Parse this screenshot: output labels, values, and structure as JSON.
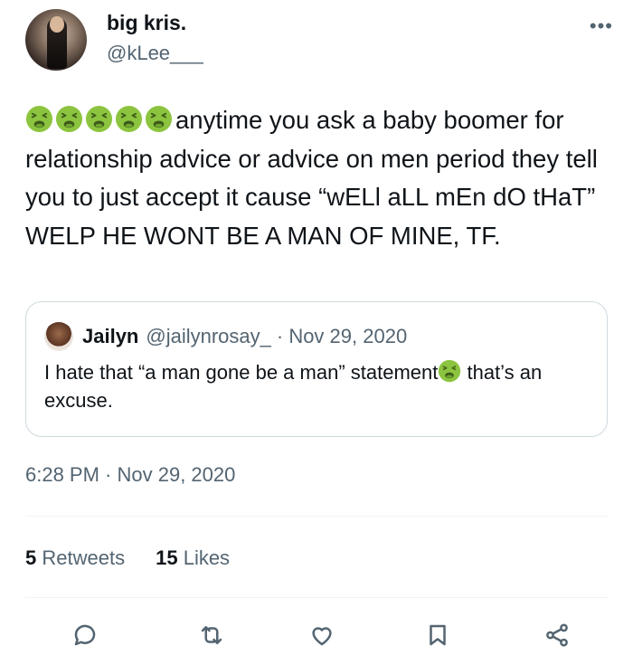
{
  "author": {
    "name": "big kris.",
    "handle": "@kLee___"
  },
  "more_label": "•••",
  "tweet": {
    "emoji_prefix": [
      "nauseated-face",
      "nauseated-face",
      "nauseated-face",
      "nauseated-face",
      "nauseated-face"
    ],
    "text": "anytime you ask a baby boomer for relationship advice or advice on men period they tell you to just accept it cause “wELl aLL mEn dO tHaT” WELP HE WONT BE A MAN OF MINE, TF."
  },
  "quoted_tweet": {
    "author_name": "Jailyn",
    "author_handle": "@jailynrosay_",
    "date": "· Nov 29, 2020",
    "text_before_emoji": "I hate that “a man gone be a man” statement",
    "emoji": "nauseated-face",
    "text_after_emoji": " that’s an excuse."
  },
  "timestamp": "6:28 PM · Nov 29, 2020",
  "stats": {
    "retweets_count": "5",
    "retweets_label": "Retweets",
    "likes_count": "15",
    "likes_label": "Likes"
  },
  "colors": {
    "text": "#0f1419",
    "secondary": "#536471",
    "border": "#cfd9de",
    "emoji_face": "#8cc43f"
  }
}
